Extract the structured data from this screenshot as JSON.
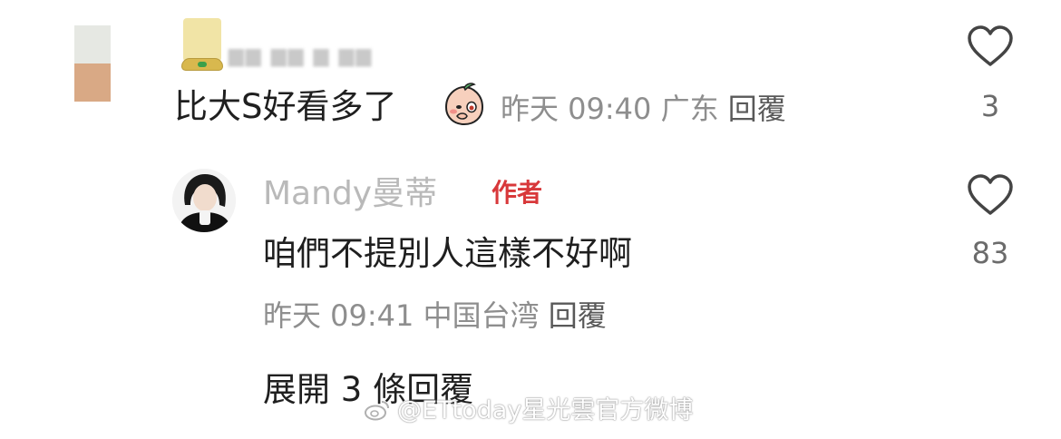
{
  "comment": {
    "text": "比大S好看多了",
    "emoji": "blush-peach-emoji",
    "time": "昨天 09:40",
    "location": "广东",
    "reply_label": "回覆",
    "likes": "3"
  },
  "reply": {
    "username": "Mandy曼蒂",
    "author_badge": "作者",
    "text": "咱們不提別人這樣不好啊",
    "time": "昨天 09:41",
    "location": "中国台湾",
    "reply_label": "回覆",
    "likes": "83"
  },
  "expand_label": "展開 3 條回覆",
  "watermark": "@ETtoday星光雲官方微博",
  "colors": {
    "author_badge": "#d8383a",
    "meta": "#8e8e8e",
    "username": "#b9b9b9"
  }
}
